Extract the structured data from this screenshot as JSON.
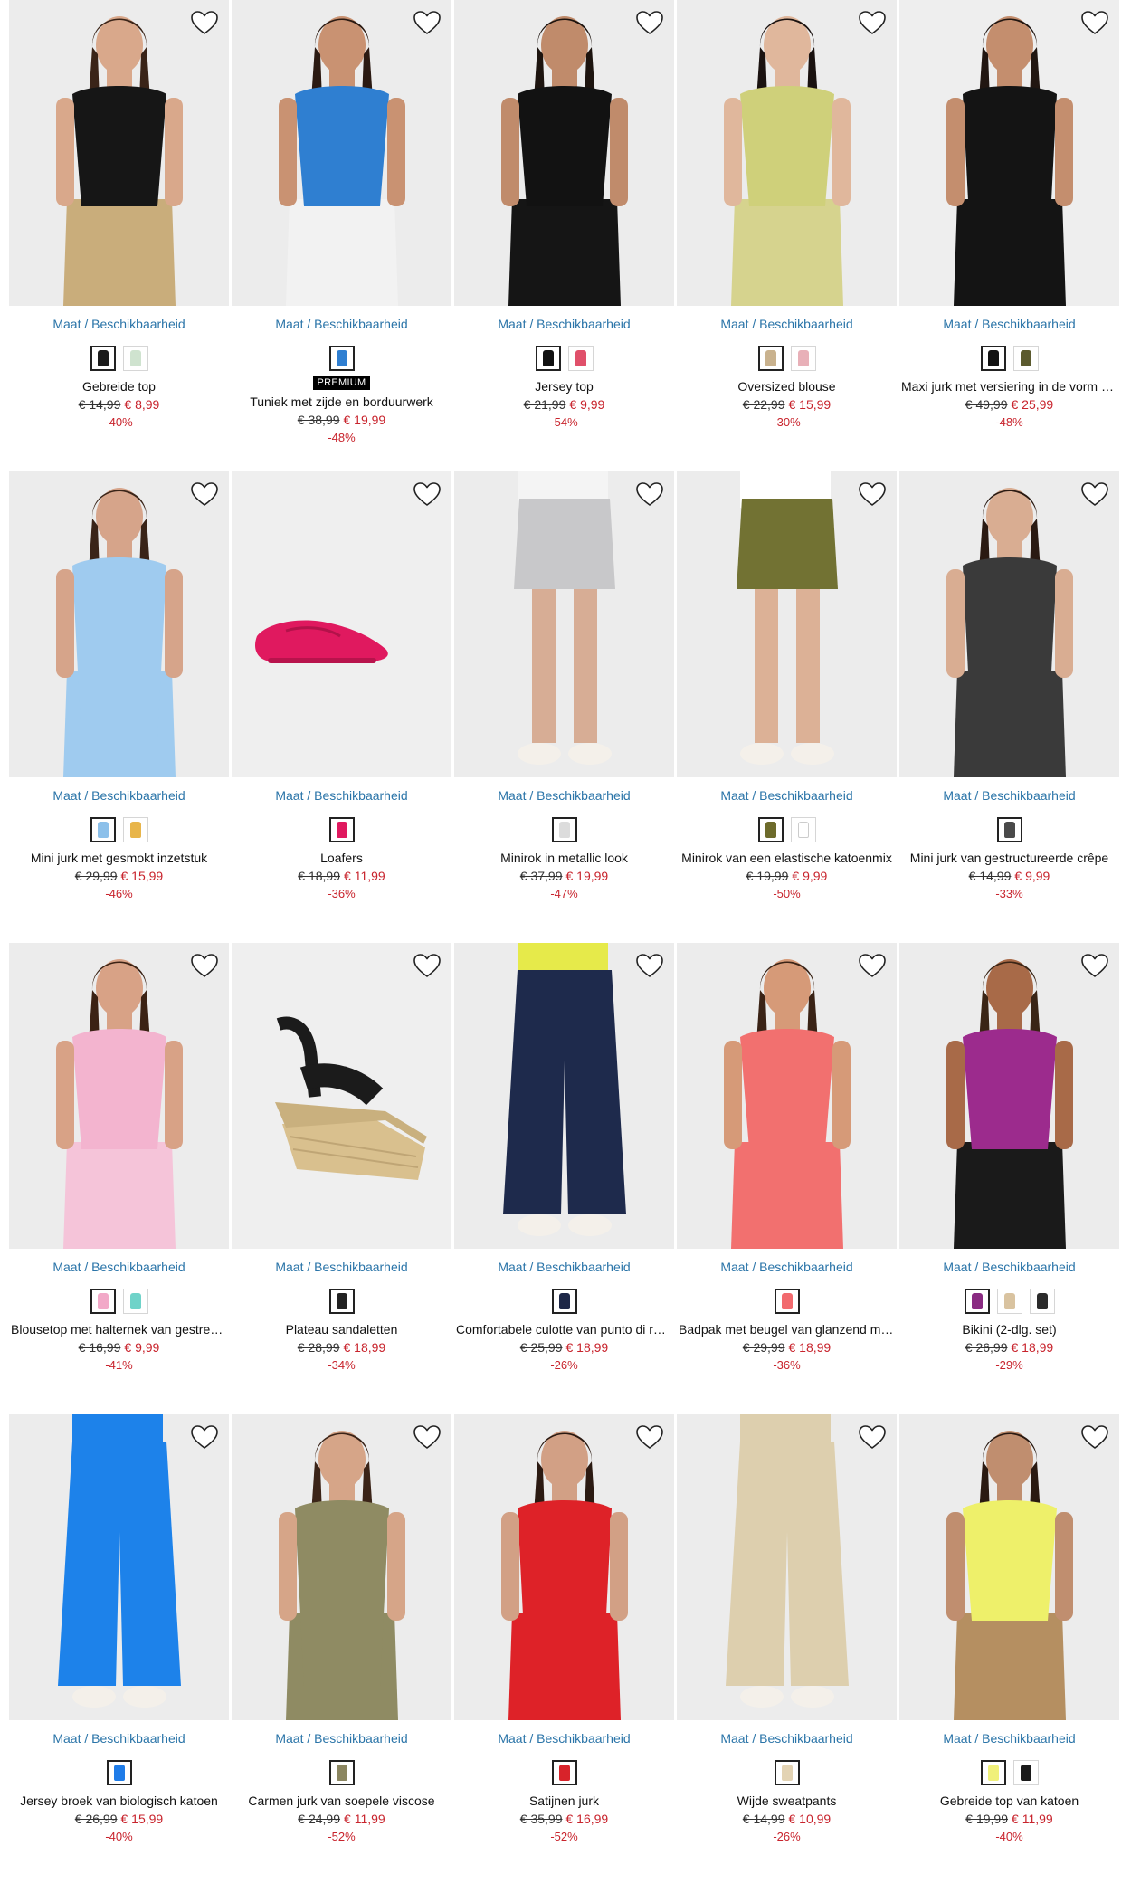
{
  "size_link": "Maat / Beschikbaarheid",
  "colors": {
    "link": "#2a74a8",
    "sale": "#c8232c",
    "photo_bg": "#ededed"
  },
  "products": [
    {
      "name": "Gebreide top",
      "old_price": "€ 14,99",
      "new_price": "€ 8,99",
      "discount": "-40%",
      "badge": "",
      "swatches": [
        "#1b1b1b",
        "#cfe3cf"
      ],
      "icon": "sleeveless-top",
      "garment": "#161616",
      "skin": "#d9a88b",
      "hair": "#3a2418",
      "lower": "#c9ad7b",
      "bg": "#ececec"
    },
    {
      "name": "Tuniek met zijde en borduurwerk",
      "old_price": "€ 38,99",
      "new_price": "€ 19,99",
      "discount": "-48%",
      "badge": "PREMIUM",
      "swatches": [
        "#2f7fd1"
      ],
      "icon": "tunic",
      "garment": "#2f7fd1",
      "skin": "#c99272",
      "hair": "#2b1a12",
      "lower": "#f2f2f2",
      "bg": "#ececec"
    },
    {
      "name": "Jersey top",
      "old_price": "€ 21,99",
      "new_price": "€ 9,99",
      "discount": "-54%",
      "badge": "",
      "swatches": [
        "#111111",
        "#e0506a"
      ],
      "icon": "ruffle-top",
      "garment": "#121212",
      "skin": "#c08b6b",
      "hair": "#1d140f",
      "lower": "#151515",
      "bg": "#ececec"
    },
    {
      "name": "Oversized blouse",
      "old_price": "€ 22,99",
      "new_price": "€ 15,99",
      "discount": "-30%",
      "badge": "",
      "swatches": [
        "#c9b28e",
        "#e8b0b8"
      ],
      "icon": "blouse",
      "garment": "#cfd07a",
      "skin": "#e0b79c",
      "hair": "#1a1210",
      "lower": "#d6d38e",
      "bg": "#ececec"
    },
    {
      "name": "Maxi jurk met versiering in de vorm van studs",
      "old_price": "€ 49,99",
      "new_price": "€ 25,99",
      "discount": "-48%",
      "badge": "",
      "swatches": [
        "#121212",
        "#5b5a2e"
      ],
      "icon": "maxi-dress",
      "garment": "#141414",
      "skin": "#c48e6e",
      "hair": "#211611",
      "lower": "#141414",
      "bg": "#eeeeee"
    },
    {
      "name": "Mini jurk met gesmokt inzetstuk",
      "old_price": "€ 29,99",
      "new_price": "€ 15,99",
      "discount": "-46%",
      "badge": "",
      "swatches": [
        "#8cc0ea",
        "#e8b54a"
      ],
      "icon": "smocked-dress",
      "garment": "#9fcbef",
      "skin": "#d6a48a",
      "hair": "#3a2418",
      "lower": "#9fcbef",
      "bg": "#ececec"
    },
    {
      "name": "Loafers",
      "old_price": "€ 18,99",
      "new_price": "€ 11,99",
      "discount": "-36%",
      "badge": "",
      "swatches": [
        "#e0195f"
      ],
      "icon": "loafer",
      "garment": "#e0195f",
      "skin": "",
      "hair": "",
      "lower": "",
      "bg": "#efefef"
    },
    {
      "name": "Minirok in metallic look",
      "old_price": "€ 37,99",
      "new_price": "€ 19,99",
      "discount": "-47%",
      "badge": "",
      "swatches": [
        "#dcdcdc"
      ],
      "icon": "metallic-skirt",
      "garment": "#c8c8ca",
      "skin": "#d7ad95",
      "hair": "",
      "lower": "#f4f4f4",
      "bg": "#ececec"
    },
    {
      "name": "Minirok van een elastische katoenmix",
      "old_price": "€ 19,99",
      "new_price": "€ 9,99",
      "discount": "-50%",
      "badge": "",
      "swatches": [
        "#6d6b2b",
        "#ffffff"
      ],
      "icon": "cargo-skirt",
      "garment": "#727233",
      "skin": "#dcb196",
      "hair": "",
      "lower": "#ffffff",
      "bg": "#ececec"
    },
    {
      "name": "Mini jurk van gestructureerde crêpe",
      "old_price": "€ 14,99",
      "new_price": "€ 9,99",
      "discount": "-33%",
      "badge": "",
      "swatches": [
        "#4a4a4a"
      ],
      "icon": "dotted-dress",
      "garment": "#3a3a3a",
      "skin": "#d9ad92",
      "hair": "#2a1a12",
      "lower": "#3a3a3a",
      "bg": "#ececec"
    },
    {
      "name": "Blousetop met halternek van gestreepte viscose",
      "old_price": "€ 16,99",
      "new_price": "€ 9,99",
      "discount": "-41%",
      "badge": "",
      "swatches": [
        "#f2a9c8",
        "#6fd3c9"
      ],
      "icon": "halter-top",
      "garment": "#f3b4cf",
      "skin": "#d8a286",
      "hair": "#3b2214",
      "lower": "#f5c4d9",
      "bg": "#ececec"
    },
    {
      "name": "Plateau sandaletten",
      "old_price": "€ 28,99",
      "new_price": "€ 18,99",
      "discount": "-34%",
      "badge": "",
      "swatches": [
        "#222222"
      ],
      "icon": "platform-sandal",
      "garment": "#1b1b1b",
      "skin": "",
      "hair": "",
      "lower": "",
      "bg": "#efefef"
    },
    {
      "name": "Comfortabele culotte van punto di roma",
      "old_price": "€ 25,99",
      "new_price": "€ 18,99",
      "discount": "-26%",
      "badge": "",
      "swatches": [
        "#1d2747"
      ],
      "icon": "culotte",
      "garment": "#1e2a4c",
      "skin": "#dcb196",
      "hair": "",
      "lower": "#e6ea4a",
      "bg": "#ececec"
    },
    {
      "name": "Badpak met beugel van glanzend materiaal",
      "old_price": "€ 29,99",
      "new_price": "€ 18,99",
      "discount": "-36%",
      "badge": "",
      "swatches": [
        "#f26a6e"
      ],
      "icon": "swimsuit",
      "garment": "#f2706f",
      "skin": "#d69a78",
      "hair": "#3a2316",
      "lower": "#f2706f",
      "bg": "#ececec"
    },
    {
      "name": "Bikini (2-dlg. set)",
      "old_price": "€ 26,99",
      "new_price": "€ 18,99",
      "discount": "-29%",
      "badge": "",
      "swatches": [
        "#8a2b82",
        "#d9c3a0",
        "#2b2b2b"
      ],
      "icon": "bikini",
      "garment": "#9c2b8d",
      "skin": "#a86a48",
      "hair": "#3a2516",
      "lower": "#1a1a1a",
      "bg": "#ececec"
    },
    {
      "name": "Jersey broek van biologisch katoen",
      "old_price": "€ 26,99",
      "new_price": "€ 15,99",
      "discount": "-40%",
      "badge": "",
      "swatches": [
        "#1f7ce8"
      ],
      "icon": "trousers",
      "garment": "#1d82ea",
      "skin": "#dcb196",
      "hair": "",
      "lower": "#1d82ea",
      "bg": "#ececec"
    },
    {
      "name": "Carmen jurk van soepele viscose",
      "old_price": "€ 24,99",
      "new_price": "€ 11,99",
      "discount": "-52%",
      "badge": "",
      "swatches": [
        "#8b8660"
      ],
      "icon": "off-shoulder-dress",
      "garment": "#8f8b63",
      "skin": "#d6a588",
      "hair": "#3b2418",
      "lower": "#8f8b63",
      "bg": "#ececec"
    },
    {
      "name": "Satijnen jurk",
      "old_price": "€ 35,99",
      "new_price": "€ 16,99",
      "discount": "-52%",
      "badge": "",
      "swatches": [
        "#d8232a"
      ],
      "icon": "satin-dress",
      "garment": "#de2228",
      "skin": "#d2a085",
      "hair": "#2b1a12",
      "lower": "#de2228",
      "bg": "#ececec"
    },
    {
      "name": "Wijde sweatpants",
      "old_price": "€ 14,99",
      "new_price": "€ 10,99",
      "discount": "-26%",
      "badge": "",
      "swatches": [
        "#e3d3b3"
      ],
      "icon": "sweatpants",
      "garment": "#ddcfae",
      "skin": "#dcb196",
      "hair": "",
      "lower": "#ddcfae",
      "bg": "#ececec"
    },
    {
      "name": "Gebreide top van katoen",
      "old_price": "€ 19,99",
      "new_price": "€ 11,99",
      "discount": "-40%",
      "badge": "",
      "swatches": [
        "#f0f07a",
        "#1a1a1a"
      ],
      "icon": "knit-top",
      "garment": "#eef06a",
      "skin": "#c08e6f",
      "hair": "#2a1a12",
      "lower": "#b58f61",
      "bg": "#ececec"
    }
  ]
}
